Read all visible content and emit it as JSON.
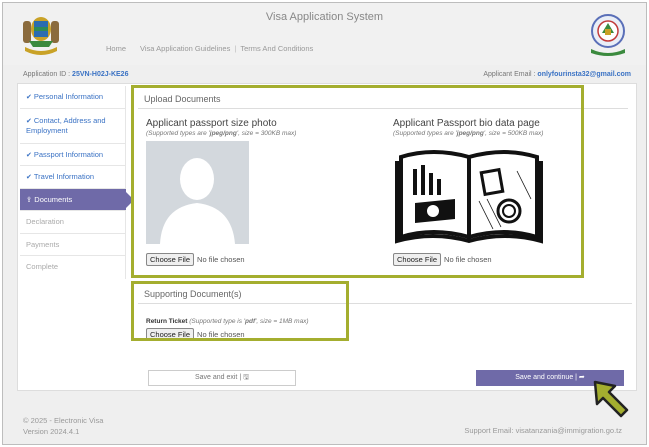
{
  "header": {
    "title": "Visa Application System",
    "nav": [
      "Home",
      "Visa Application Guidelines",
      "|",
      "Terms And Conditions"
    ]
  },
  "info": {
    "application_label": "Application ID :",
    "application_id": "25VN-H02J-KE26",
    "email_label": "Applicant Email :",
    "email": "onlyfourinsta32@gmail.com"
  },
  "sidebar": {
    "items": [
      {
        "label": "Personal Information",
        "done": true
      },
      {
        "label": "Contact, Address and Employment",
        "done": true
      },
      {
        "label": "Passport Information",
        "done": true
      },
      {
        "label": "Travel Information",
        "done": true
      },
      {
        "label": "Documents",
        "active": true
      },
      {
        "label": "Declaration"
      },
      {
        "label": "Payments"
      },
      {
        "label": "Complete"
      }
    ]
  },
  "upload": {
    "section_title": "Upload Documents",
    "photo": {
      "title": "Applicant passport size photo",
      "hint_prefix": "(Supported types are ",
      "hint_types": "jpeg/png",
      "hint_suffix": ", size = 300KB max)"
    },
    "passport": {
      "title": "Applicant Passport bio data page",
      "hint_prefix": "(Supported types are ",
      "hint_types": "jpeg/png",
      "hint_suffix": ", size = 500KB max)"
    },
    "choose_file": "Choose File",
    "no_file": "No file chosen"
  },
  "supporting": {
    "section_title": "Supporting Document(s)",
    "return_label": "Return Ticket",
    "return_hint": " (Supported type is ",
    "return_type": "pdf",
    "return_hint_suffix": ", size = 1MB max)"
  },
  "buttons": {
    "save_exit": "Save and exit | 🖫",
    "continue": "Save and continue | ➦"
  },
  "footer": {
    "copyright": "© 2025 - Electronic Visa",
    "version": "Version 2024.4.1",
    "support": "Support Email: visatanzania@immigration.go.tz"
  },
  "colors": {
    "accent": "#6f6aa8",
    "link": "#3a72c4",
    "highlight": "#a4ae2f"
  }
}
